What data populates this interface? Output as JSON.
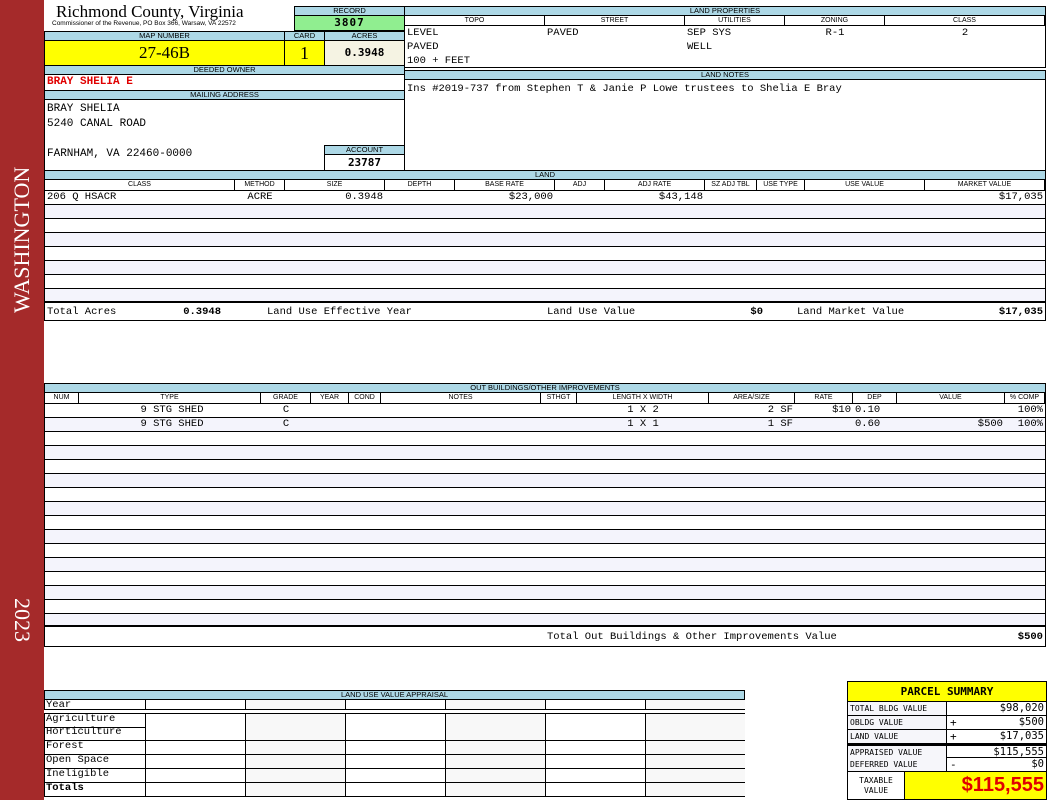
{
  "sidebar": {
    "district": "WASHINGTON",
    "year": "2023",
    "color": "#a52a2a"
  },
  "header": {
    "title": "Richmond County, Virginia",
    "subtitle": "Commissioner of the Revenue, PO Box 366, Warsaw, VA 22572"
  },
  "record": {
    "label": "RECORD",
    "value": "3807"
  },
  "map": {
    "label": "MAP NUMBER",
    "value": "27-46B"
  },
  "card": {
    "label": "CARD",
    "value": "1"
  },
  "acres": {
    "label": "ACRES",
    "value": "0.3948"
  },
  "owner": {
    "label": "DEEDED OWNER",
    "value": "BRAY SHELIA E"
  },
  "mailing": {
    "label": "MAILING ADDRESS",
    "lines": [
      "BRAY SHELIA",
      "5240 CANAL ROAD",
      "FARNHAM, VA 22460-0000"
    ]
  },
  "account": {
    "label": "ACCOUNT",
    "value": "23787"
  },
  "land_properties": {
    "label": "LAND PROPERTIES",
    "headers": [
      "TOPO",
      "STREET",
      "UTILITIES",
      "ZONING",
      "CLASS"
    ],
    "topo": [
      "LEVEL",
      "PAVED",
      "100 + FEET"
    ],
    "street": [
      "PAVED"
    ],
    "utilities": [
      "SEP SYS",
      "WELL"
    ],
    "zoning": "R-1",
    "class": "2"
  },
  "land_notes": {
    "label": "LAND NOTES",
    "text": "Ins #2019-737 from Stephen T & Janie P Lowe trustees to Shelia E Bray"
  },
  "land": {
    "label": "LAND",
    "headers": [
      "CLASS",
      "METHOD",
      "SIZE",
      "DEPTH",
      "BASE RATE",
      "ADJ",
      "ADJ RATE",
      "SZ ADJ TBL",
      "USE TYPE",
      "USE VALUE",
      "MARKET VALUE"
    ],
    "rows": [
      [
        "206 Q HSACR",
        "ACRE",
        "0.3948",
        "",
        "$23,000",
        "",
        "$43,148",
        "",
        "",
        "",
        "$17,035"
      ]
    ],
    "totals": {
      "acres_label": "Total Acres",
      "acres": "0.3948",
      "eff_year_label": "Land Use Effective Year",
      "eff_year": "",
      "use_value_label": "Land Use Value",
      "use_value": "$0",
      "market_label": "Land Market Value",
      "market": "$17,035"
    }
  },
  "outbuildings": {
    "label": "OUT BUILDINGS/OTHER IMPROVEMENTS",
    "headers": [
      "NUM",
      "TYPE",
      "GRADE",
      "YEAR",
      "COND",
      "NOTES",
      "STHGT",
      "LENGTH X WIDTH",
      "AREA/SIZE",
      "RATE",
      "DEP",
      "VALUE",
      "% COMP"
    ],
    "rows": [
      [
        "",
        "9 STG SHED",
        "C",
        "",
        "",
        "",
        "",
        "1 X 2",
        "2 SF",
        "$10",
        "0.10",
        "",
        "100%"
      ],
      [
        "",
        "9 STG SHED",
        "C",
        "",
        "",
        "",
        "",
        "1 X 1",
        "1 SF",
        "",
        "0.60",
        "$500",
        "100%"
      ]
    ],
    "total_label": "Total Out Buildings & Other Improvements Value",
    "total": "$500"
  },
  "land_use": {
    "label": "LAND USE VALUE APPRAISAL",
    "year_label": "Year",
    "rows": [
      "Agriculture",
      "Horticulture",
      "Forest",
      "Open Space",
      "Ineligible",
      "Totals"
    ]
  },
  "summary": {
    "title": "PARCEL SUMMARY",
    "rows": [
      {
        "label": "TOTAL BLDG VALUE",
        "op": "",
        "value": "$98,020"
      },
      {
        "label": "OBLDG VALUE",
        "op": "+",
        "value": "$500"
      },
      {
        "label": "LAND VALUE",
        "op": "+",
        "value": "$17,035"
      },
      {
        "label": "APPRAISED VALUE",
        "op": "",
        "value": "$115,555"
      },
      {
        "label": "DEFERRED VALUE",
        "op": "-",
        "value": "$0"
      }
    ],
    "taxable_label": "TAXABLE VALUE",
    "taxable": "$115,555"
  },
  "colors": {
    "label_bg": "#add8e6",
    "highlight": "#ffff00",
    "record_bg": "#90ee90",
    "owner": "#e00000",
    "taxable": "#e00000"
  }
}
